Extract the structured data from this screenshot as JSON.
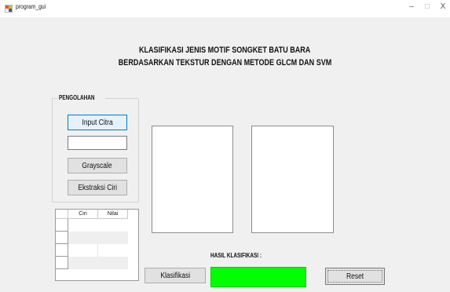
{
  "window": {
    "title": "program_gui",
    "minimize": "–",
    "maximize": "□",
    "close": "X"
  },
  "heading": {
    "line1": "KLASIFIKASI JENIS MOTIF SONGKET BATU BARA",
    "line2": "BERDASARKAN TEKSTUR DENGAN METODE GLCM DAN SVM"
  },
  "pengolahan": {
    "title": "PENGOLAHAN",
    "input_citra": "Input Citra",
    "path_value": "",
    "grayscale": "Grayscale",
    "ekstraksi": "Ekstraksi Ciri"
  },
  "table": {
    "columns": [
      "Ciri",
      "Nilai"
    ],
    "rows": [
      [
        "",
        ""
      ],
      [
        "",
        ""
      ],
      [
        "",
        ""
      ],
      [
        "",
        ""
      ]
    ]
  },
  "hasil": {
    "label": "HASIL KLASIFIKASI :",
    "value": ""
  },
  "buttons": {
    "klasifikasi": "Klasifikasi",
    "reset": "Reset"
  },
  "colors": {
    "result_fill": "#00ff00",
    "focus_border": "#0078d7"
  }
}
